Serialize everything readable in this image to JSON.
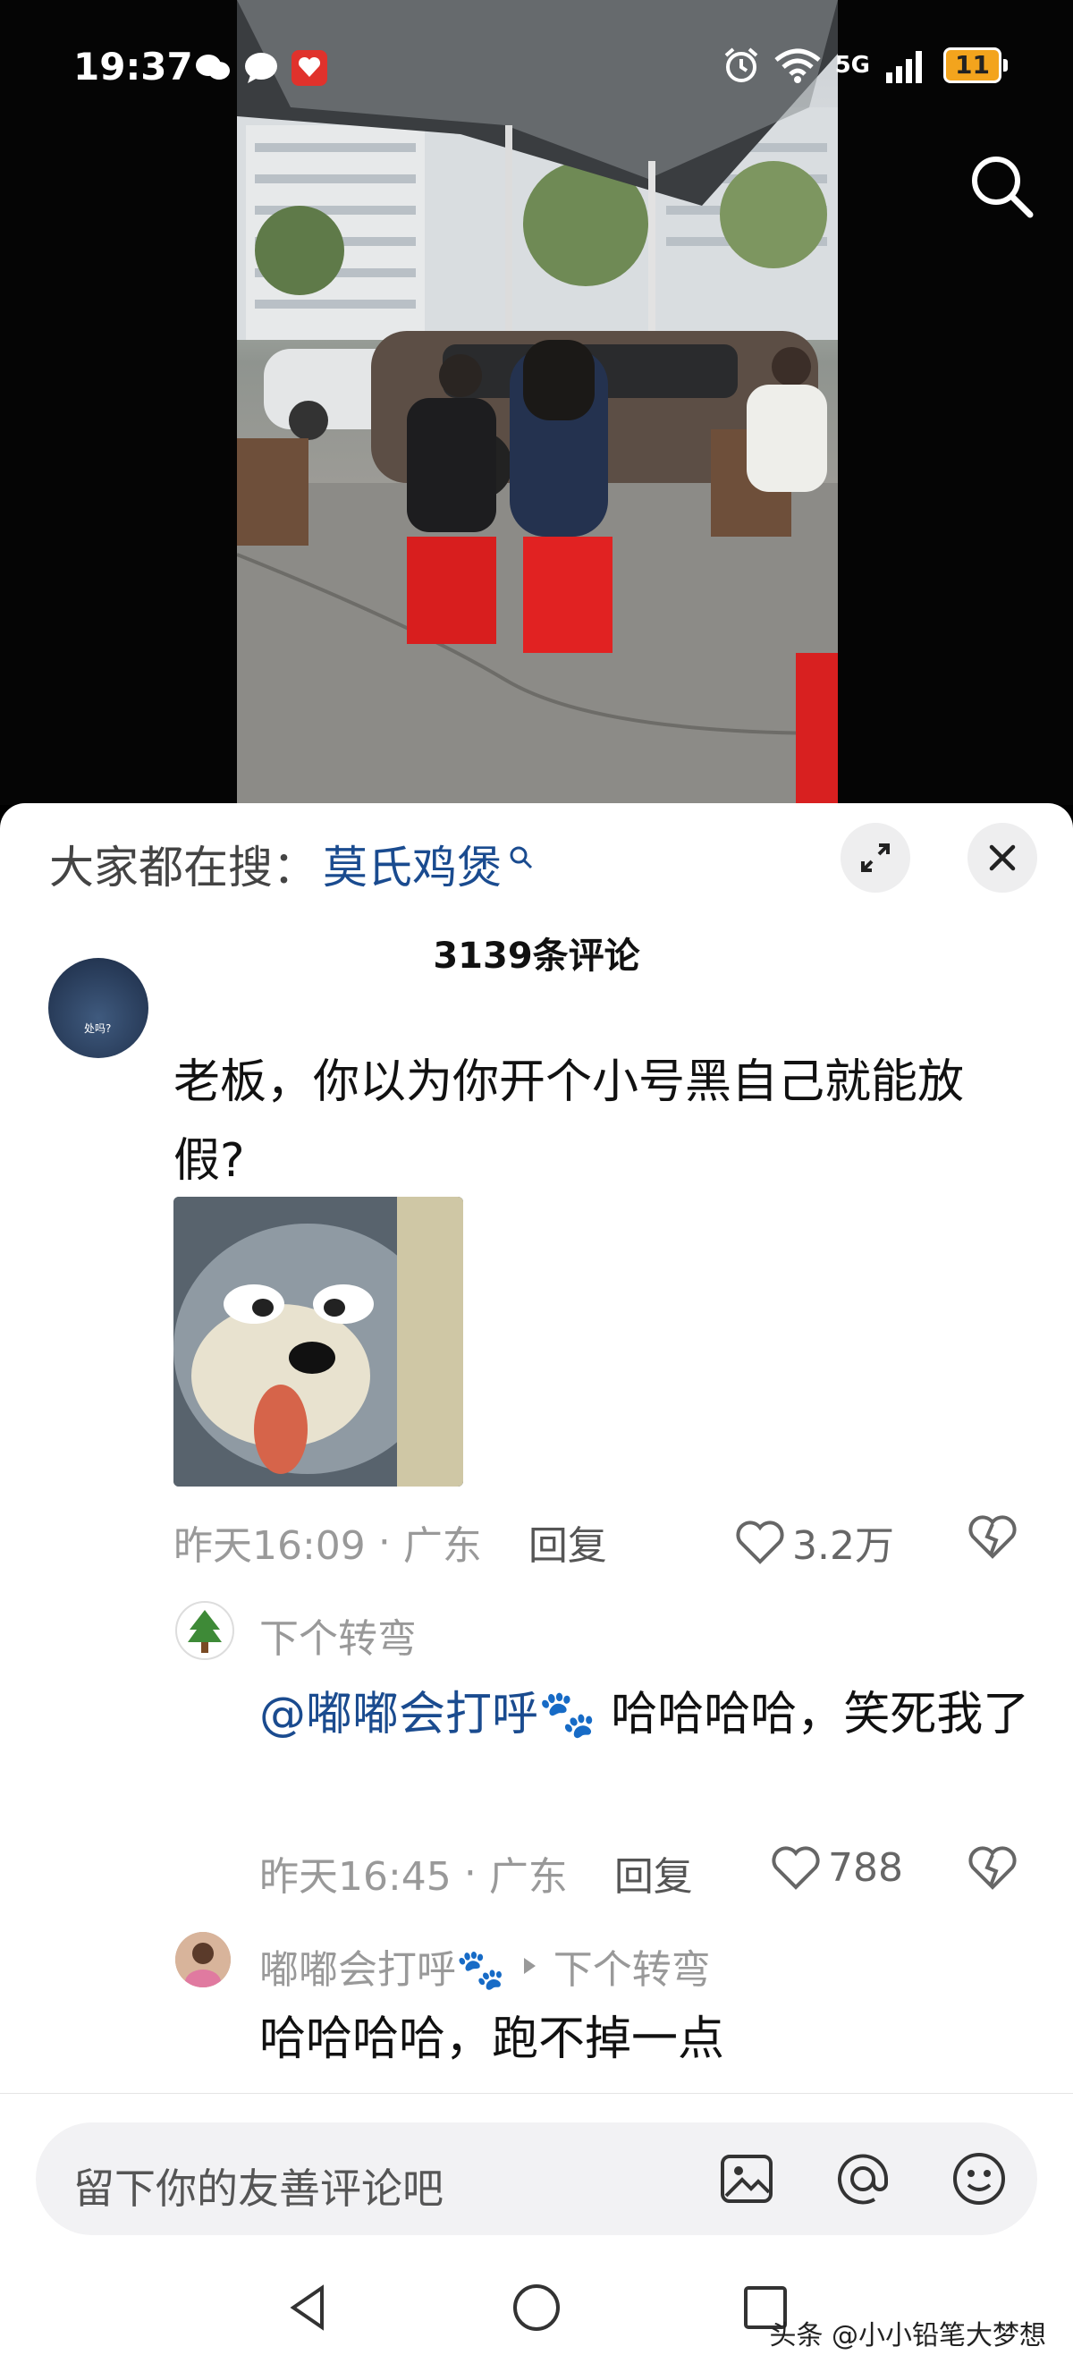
{
  "status": {
    "time": "19:37",
    "network": "5G",
    "battery": "11",
    "sim": "6"
  },
  "hot_search": {
    "label": "大家都在搜：",
    "keyword": "莫氏鸡煲"
  },
  "comments_header": {
    "count_label": "3139条评论"
  },
  "main_comment": {
    "avatar_caption": "处吗?",
    "text": "老板，你以为你开个小号黑自己就能放假?",
    "time": "昨天16:09",
    "location": "广东",
    "reply_label": "回复",
    "likes": "3.2万"
  },
  "reply1": {
    "author": "下个转弯",
    "mention": "@嘟嘟会打呼🐾",
    "text": " 哈哈哈哈，笑死我了",
    "time": "昨天16:45",
    "location": "广东",
    "reply_label": "回复",
    "likes": "788"
  },
  "reply2": {
    "author": "嘟嘟会打呼🐾",
    "target": "下个转弯",
    "text": "哈哈哈哈，跑不掉一点"
  },
  "input": {
    "placeholder": "留下你的友善评论吧"
  },
  "watermark": "头条 @小小铅笔大梦想",
  "colors": {
    "accent_link": "#1a4b8f",
    "battery": "#f3a41d"
  }
}
